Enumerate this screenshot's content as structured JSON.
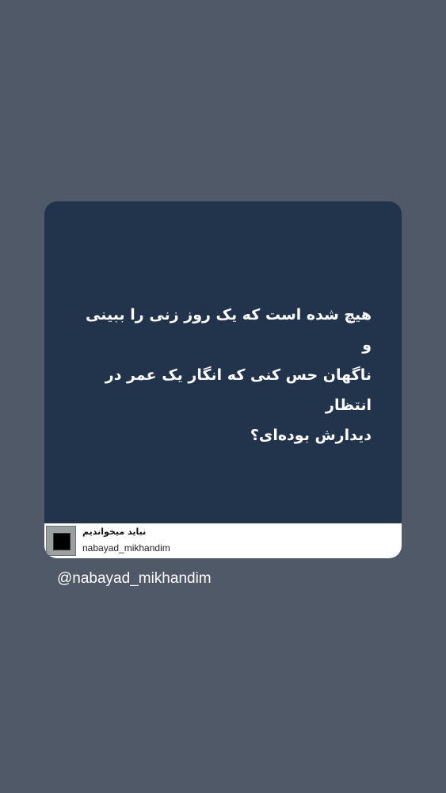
{
  "post": {
    "quote_lines": [
      "هیچ شده است که یک روز زنی را ببینی و",
      "ناگهان حس کنی که انگار یک عمر در انتظار",
      "دیدارش بوده‌ای؟"
    ],
    "account_name": "نباید میخواندیم",
    "account_handle": "nabayad_mikhandim"
  },
  "overlay": {
    "mention": "@nabayad_mikhandim"
  },
  "colors": {
    "background": "#4f5968",
    "card": "#22344b",
    "footer": "#ffffff"
  }
}
